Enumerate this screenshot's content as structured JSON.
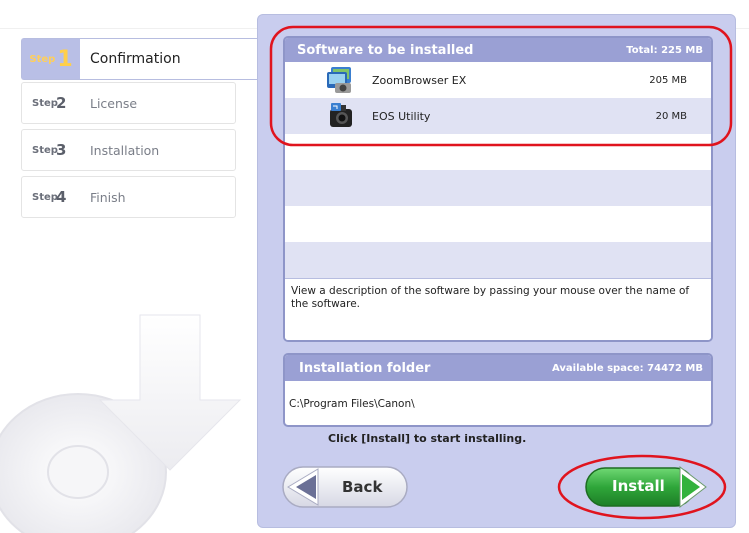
{
  "steps": [
    {
      "prefix": "Step",
      "num": "1",
      "label": "Confirmation",
      "active": true
    },
    {
      "prefix": "Step",
      "num": "2",
      "label": "License",
      "active": false
    },
    {
      "prefix": "Step",
      "num": "3",
      "label": "Installation",
      "active": false
    },
    {
      "prefix": "Step",
      "num": "4",
      "label": "Finish",
      "active": false
    }
  ],
  "software": {
    "title": "Software to be installed",
    "total": "Total: 225 MB",
    "items": [
      {
        "name": "ZoomBrowser EX",
        "size": "205 MB",
        "icon": "zoombrowser-icon"
      },
      {
        "name": "EOS Utility",
        "size": "20 MB",
        "icon": "eos-utility-icon"
      }
    ],
    "description": "View a description of the software by passing your mouse over the name of the software."
  },
  "folder": {
    "title": "Installation folder",
    "available": "Available space: 74472 MB",
    "path": "C:\\Program Files\\Canon\\"
  },
  "hint": "Click [Install] to start installing.",
  "buttons": {
    "back": "Back",
    "install": "Install"
  },
  "colors": {
    "accent": "#9aa0d4",
    "panel": "#c9cdee",
    "install_green": "#2fa63a",
    "annotation_red": "#e0141e",
    "step_highlight": "#ffcf4a"
  }
}
